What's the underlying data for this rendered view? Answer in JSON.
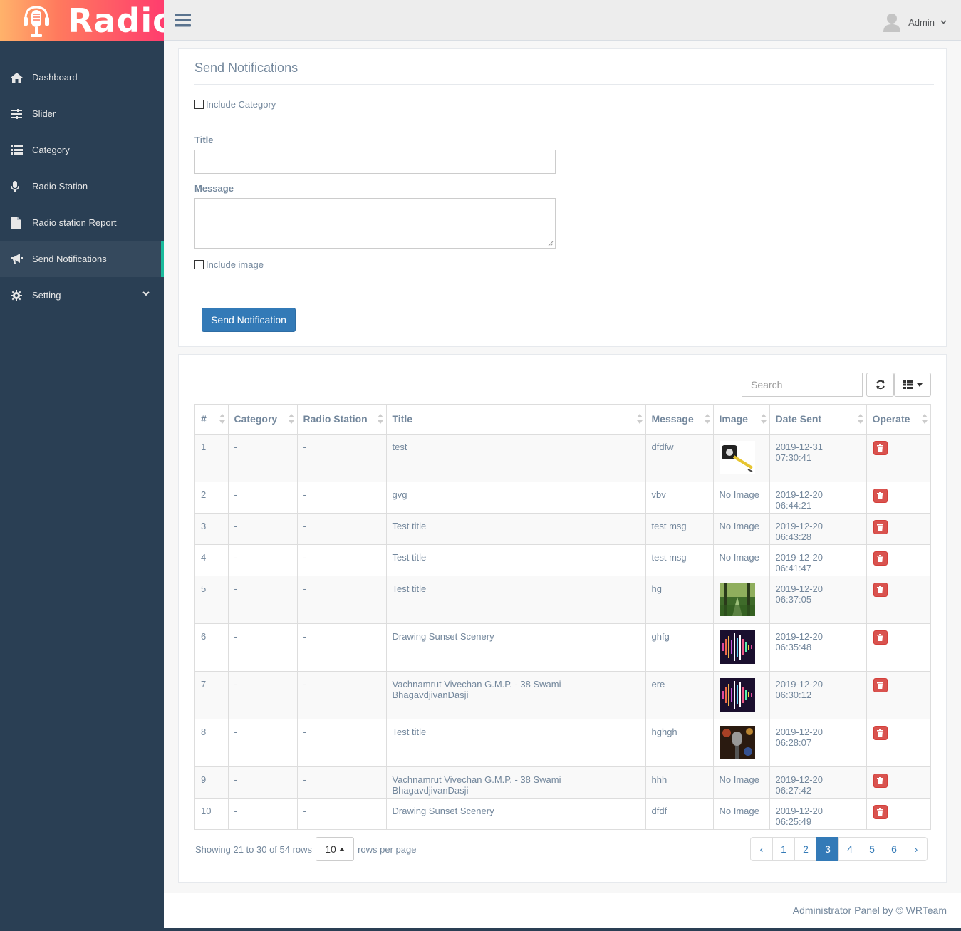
{
  "app": {
    "brand": "Radio",
    "footer": "Administrator Panel by © WRTeam"
  },
  "user": {
    "name": "Admin"
  },
  "sidebar": {
    "items": [
      {
        "label": "Dashboard",
        "icon": "home-icon"
      },
      {
        "label": "Slider",
        "icon": "sliders-icon"
      },
      {
        "label": "Category",
        "icon": "list-icon"
      },
      {
        "label": "Radio Station",
        "icon": "microphone-icon"
      },
      {
        "label": "Radio station Report",
        "icon": "file-icon"
      },
      {
        "label": "Send Notifications",
        "icon": "bullhorn-icon",
        "active": true
      },
      {
        "label": "Setting",
        "icon": "gear-icon"
      }
    ]
  },
  "form": {
    "title": "Send Notifications",
    "include_category": "Include Category",
    "title_label": "Title",
    "title_value": "",
    "message_label": "Message",
    "message_value": "",
    "include_image": "Include image",
    "submit": "Send Notification"
  },
  "table": {
    "search_placeholder": "Search",
    "columns": [
      "#",
      "Category",
      "Radio Station",
      "Title",
      "Message",
      "Image",
      "Date Sent",
      "Operate"
    ],
    "rows": [
      {
        "id": "1",
        "category": "-",
        "station": "-",
        "title": "test",
        "message": "dfdfw",
        "image": "tape-measure",
        "date": "2019-12-31 07:30:41"
      },
      {
        "id": "2",
        "category": "-",
        "station": "-",
        "title": "gvg",
        "message": "vbv",
        "image": "No Image",
        "date": "2019-12-20 06:44:21"
      },
      {
        "id": "3",
        "category": "-",
        "station": "-",
        "title": "Test title",
        "message": "test msg",
        "image": "No Image",
        "date": "2019-12-20 06:43:28"
      },
      {
        "id": "4",
        "category": "-",
        "station": "-",
        "title": "Test title",
        "message": "test msg",
        "image": "No Image",
        "date": "2019-12-20 06:41:47"
      },
      {
        "id": "5",
        "category": "-",
        "station": "-",
        "title": "Test title",
        "message": "hg",
        "image": "forest",
        "date": "2019-12-20 06:37:05"
      },
      {
        "id": "6",
        "category": "-",
        "station": "-",
        "title": "Drawing Sunset Scenery",
        "message": "ghfg",
        "image": "soundwave",
        "date": "2019-12-20 06:35:48"
      },
      {
        "id": "7",
        "category": "-",
        "station": "-",
        "title": "Vachnamrut Vivechan G.M.P. - 38 Swami BhagavdjivanDasji",
        "message": "ere",
        "image": "soundwave",
        "date": "2019-12-20 06:30:12"
      },
      {
        "id": "8",
        "category": "-",
        "station": "-",
        "title": "Test title",
        "message": "hghgh",
        "image": "microphone",
        "date": "2019-12-20 06:28:07"
      },
      {
        "id": "9",
        "category": "-",
        "station": "-",
        "title": "Vachnamrut Vivechan G.M.P. - 38 Swami BhagavdjivanDasji",
        "message": "hhh",
        "image": "No Image",
        "date": "2019-12-20 06:27:42"
      },
      {
        "id": "10",
        "category": "-",
        "station": "-",
        "title": "Drawing Sunset Scenery",
        "message": "dfdf",
        "image": "No Image",
        "date": "2019-12-20 06:25:49"
      }
    ],
    "showing": "Showing 21 to 30 of 54 rows",
    "rows_per_page": "10",
    "rows_per_page_label": "rows per page",
    "pages": [
      "‹",
      "1",
      "2",
      "3",
      "4",
      "5",
      "6",
      "›"
    ],
    "current_page": "3"
  },
  "colors": {
    "sidebar": "#2a3f54",
    "accent": "#1abb9c",
    "primary": "#337ab7",
    "danger": "#d9534f"
  }
}
